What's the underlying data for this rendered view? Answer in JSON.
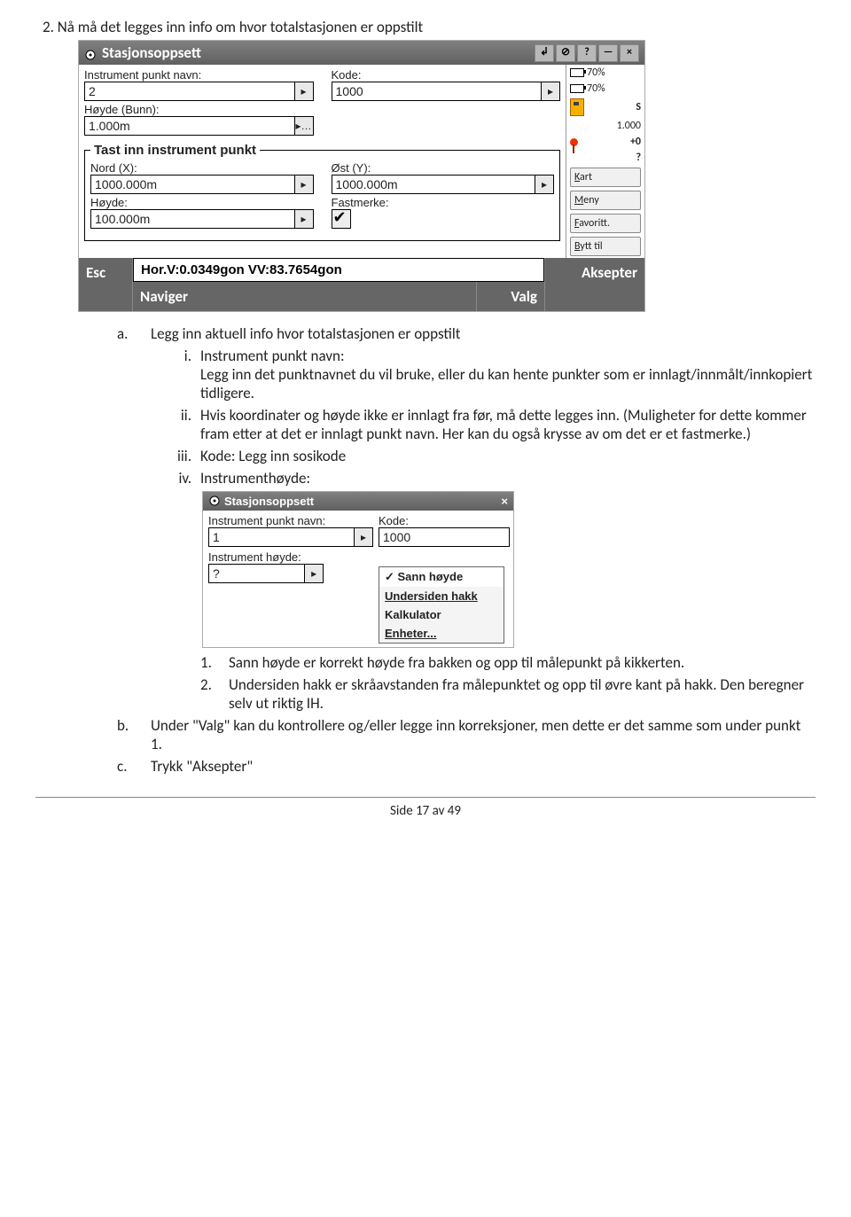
{
  "doc": {
    "heading": "2.   Nå må det legges inn info om hvor totalstasjonen er oppstilt"
  },
  "shot1": {
    "title": "Stasjonsoppsett",
    "fields": {
      "instr_navn_lbl": "Instrument punkt navn:",
      "instr_navn_val": "2",
      "kode_lbl": "Kode:",
      "kode_val": "1000",
      "hoyde_bunn_lbl": "Høyde (Bunn):",
      "hoyde_bunn_val": "1.000m",
      "group_legend": "Tast inn instrument punkt",
      "nord_lbl": "Nord (X):",
      "nord_val": "1000.000m",
      "ost_lbl": "Øst (Y):",
      "ost_val": "1000.000m",
      "hoyde_lbl": "Høyde:",
      "hoyde_val": "100.000m",
      "fastmerke_lbl": "Fastmerke:"
    },
    "side": {
      "batt1": "70%",
      "batt2": "70%",
      "s": "S",
      "sval": "1.000",
      "plus": "+0",
      "q": "?",
      "kart": "Kart",
      "meny": "Meny",
      "favoritt": "Favoritt.",
      "bytt": "Bytt til"
    },
    "status": "Hor.V:0.0349gon  VV:83.7654gon",
    "esc": "Esc",
    "naviger": "Naviger",
    "valg": "Valg",
    "aksepter": "Aksepter"
  },
  "list": {
    "a": "Legg inn aktuell info hvor totalstasjonen er oppstilt",
    "i_lead": "Instrument punkt navn:",
    "i_body": "Legg inn det punktnavnet du vil bruke, eller du kan hente punkter som er innlagt/innmålt/innkopiert tidligere.",
    "ii": "Hvis koordinater og høyde ikke er innlagt fra før, må dette legges inn. (Muligheter for dette kommer fram etter at det er innlagt punkt navn. Her kan du også krysse av om det er et fastmerke.)",
    "iii": "Kode: Legg inn sosikode",
    "iv": "Instrumenthøyde:"
  },
  "shot2": {
    "title": "Stasjonsoppsett",
    "instr_navn_lbl": "Instrument punkt navn:",
    "instr_navn_val": "1",
    "kode_lbl": "Kode:",
    "kode_val": "1000",
    "instr_hoyde_lbl": "Instrument høyde:",
    "instr_hoyde_val": "?",
    "menu": {
      "sann": "Sann høyde",
      "under": "Undersiden hakk",
      "kalk": "Kalkulator",
      "enh": "Enheter..."
    }
  },
  "sublist": {
    "n1": "Sann høyde er korrekt høyde fra bakken og opp til målepunkt på kikkerten.",
    "n2": "Undersiden hakk er skråavstanden fra målepunktet og opp til øvre kant på hakk. Den beregner selv ut riktig IH.",
    "b": "Under \"Valg\" kan du kontrollere og/eller legge inn korreksjoner, men dette er det samme som under punkt 1.",
    "c": "Trykk \"Aksepter\""
  },
  "footer": "Side 17 av 49"
}
